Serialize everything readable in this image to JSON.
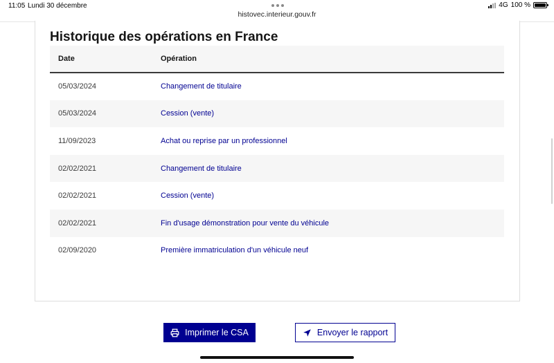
{
  "status_bar": {
    "time": "11:05",
    "date": "Lundi 30 décembre",
    "url": "histovec.interieur.gouv.fr",
    "network": "4G",
    "battery": "100 %"
  },
  "section": {
    "title": "Historique des opérations en France"
  },
  "table": {
    "headers": {
      "date": "Date",
      "operation": "Opération"
    },
    "rows": [
      {
        "date": "05/03/2024",
        "operation": "Changement de titulaire"
      },
      {
        "date": "05/03/2024",
        "operation": "Cession (vente)"
      },
      {
        "date": "11/09/2023",
        "operation": "Achat ou reprise par un professionnel"
      },
      {
        "date": "02/02/2021",
        "operation": "Changement de titulaire"
      },
      {
        "date": "02/02/2021",
        "operation": "Cession (vente)"
      },
      {
        "date": "02/02/2021",
        "operation": "Fin d'usage démonstration pour vente du véhicule"
      },
      {
        "date": "02/09/2020",
        "operation": "Première immatriculation d'un véhicule neuf"
      }
    ]
  },
  "actions": {
    "print_label": "Imprimer le CSA",
    "print_icon": "printer-icon",
    "send_label": "Envoyer le rapport",
    "send_icon": "send-icon"
  },
  "colors": {
    "primary": "#000091",
    "row_alt": "#f6f6f6",
    "text": "#161616"
  }
}
